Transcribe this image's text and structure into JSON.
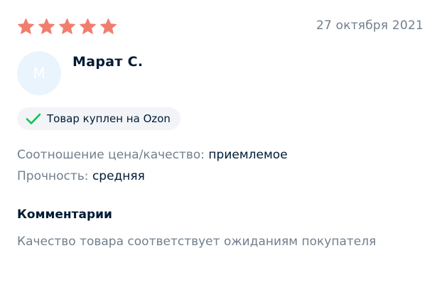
{
  "review": {
    "rating": 5,
    "rating_max": 5,
    "star_color": "#f07e6e",
    "date": "27 октября 2021",
    "author": {
      "initial": "М",
      "name": "Марат С."
    },
    "badge": {
      "icon": "check-icon",
      "check_color": "#10c44c",
      "text": "Товар куплен на Ozon"
    },
    "attributes": [
      {
        "label": "Соотношение цена/качество:",
        "value": "приемлемое"
      },
      {
        "label": "Прочность:",
        "value": "средняя"
      }
    ],
    "comments": {
      "title": "Комментарии",
      "text": "Качество товара соответствует ожиданиям покупателя"
    }
  }
}
